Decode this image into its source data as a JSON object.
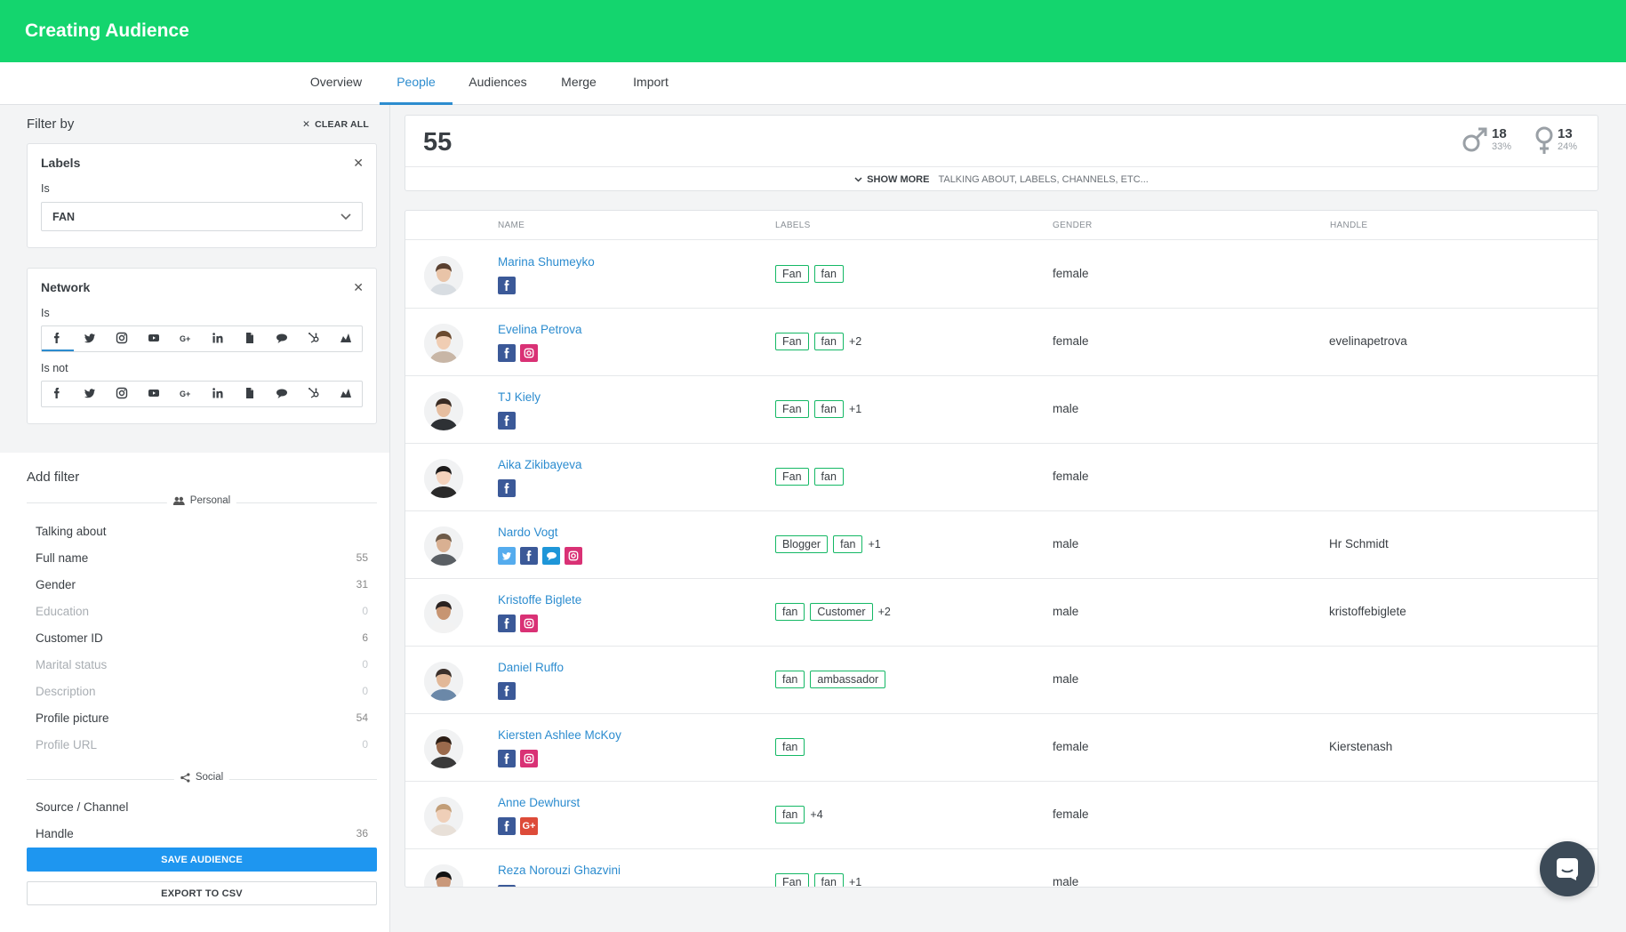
{
  "header": {
    "title": "Creating Audience",
    "accent": "#14d56e"
  },
  "tabs": [
    {
      "label": "Overview",
      "active": false
    },
    {
      "label": "People",
      "active": true
    },
    {
      "label": "Audiences",
      "active": false
    },
    {
      "label": "Merge",
      "active": false
    },
    {
      "label": "Import",
      "active": false
    }
  ],
  "sidebar": {
    "filter_by": "Filter by",
    "clear_all": "CLEAR ALL",
    "labels_card": {
      "title": "Labels",
      "is_label": "Is",
      "selected": "FAN"
    },
    "network_card": {
      "title": "Network",
      "is_label": "Is",
      "is_not_label": "Is not",
      "networks": [
        "facebook-icon",
        "twitter-icon",
        "instagram-icon",
        "youtube-icon",
        "google-plus-icon",
        "linkedin-icon",
        "document-icon",
        "chat-bubble-icon",
        "hubspot-icon",
        "analytics-icon"
      ],
      "is_selected": "facebook-icon"
    },
    "add_filter": "Add filter",
    "personal_section": "Personal",
    "personal_items": [
      {
        "label": "Talking about",
        "count": ""
      },
      {
        "label": "Full name",
        "count": "55"
      },
      {
        "label": "Gender",
        "count": "31"
      },
      {
        "label": "Education",
        "count": "0"
      },
      {
        "label": "Customer ID",
        "count": "6"
      },
      {
        "label": "Marital status",
        "count": "0"
      },
      {
        "label": "Description",
        "count": "0"
      },
      {
        "label": "Profile picture",
        "count": "54"
      },
      {
        "label": "Profile URL",
        "count": "0"
      }
    ],
    "social_section": "Social",
    "social_items": [
      {
        "label": "Source / Channel",
        "count": ""
      },
      {
        "label": "Handle",
        "count": "36"
      }
    ],
    "save_label": "SAVE AUDIENCE",
    "export_label": "EXPORT TO CSV"
  },
  "summary": {
    "count": "55",
    "male": {
      "count": "18",
      "pct": "33%"
    },
    "female": {
      "count": "13",
      "pct": "24%"
    },
    "show_more": "SHOW MORE",
    "show_more_hint": "TALKING ABOUT, LABELS, CHANNELS, ETC..."
  },
  "table": {
    "columns": [
      "NAME",
      "LABELS",
      "GENDER",
      "HANDLE"
    ],
    "rows": [
      {
        "name": "Marina Shumeyko",
        "nets": [
          "fb"
        ],
        "labels": [
          "Fan",
          "fan"
        ],
        "more": "",
        "gender": "female",
        "handle": ""
      },
      {
        "name": "Evelina Petrova",
        "nets": [
          "fb",
          "ig"
        ],
        "labels": [
          "Fan",
          "fan"
        ],
        "more": "+2",
        "gender": "female",
        "handle": "evelinapetrova"
      },
      {
        "name": "TJ Kiely",
        "nets": [
          "fb"
        ],
        "labels": [
          "Fan",
          "fan"
        ],
        "more": "+1",
        "gender": "male",
        "handle": ""
      },
      {
        "name": "Aika Zikibayeva",
        "nets": [
          "fb"
        ],
        "labels": [
          "Fan",
          "fan"
        ],
        "more": "",
        "gender": "female",
        "handle": ""
      },
      {
        "name": "Nardo Vogt",
        "nets": [
          "tw",
          "fb",
          "ch",
          "ig"
        ],
        "labels": [
          "Blogger",
          "fan"
        ],
        "more": "+1",
        "gender": "male",
        "handle": "Hr Schmidt"
      },
      {
        "name": "Kristoffe Biglete",
        "nets": [
          "fb",
          "ig"
        ],
        "labels": [
          "fan",
          "Customer"
        ],
        "more": "+2",
        "gender": "male",
        "handle": "kristoffebiglete"
      },
      {
        "name": "Daniel Ruffo",
        "nets": [
          "fb"
        ],
        "labels": [
          "fan",
          "ambassador"
        ],
        "more": "",
        "gender": "male",
        "handle": ""
      },
      {
        "name": "Kiersten Ashlee McKoy",
        "nets": [
          "fb",
          "ig"
        ],
        "labels": [
          "fan"
        ],
        "more": "",
        "gender": "female",
        "handle": "Kierstenash"
      },
      {
        "name": "Anne Dewhurst",
        "nets": [
          "fb",
          "gp"
        ],
        "labels": [
          "fan"
        ],
        "more": "+4",
        "gender": "female",
        "handle": ""
      },
      {
        "name": "Reza Norouzi Ghazvini",
        "nets": [
          "fb"
        ],
        "labels": [
          "Fan",
          "fan"
        ],
        "more": "+1",
        "gender": "male",
        "handle": ""
      }
    ]
  }
}
